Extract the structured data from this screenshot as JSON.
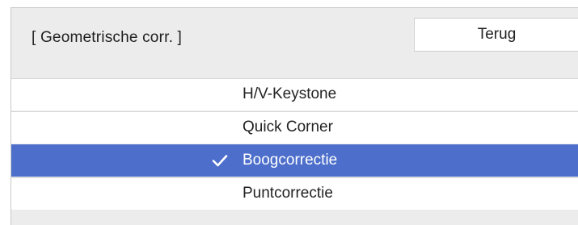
{
  "header": {
    "title": "[ Geometrische corr. ]",
    "back_label": "Terug"
  },
  "menu": {
    "items": [
      {
        "label": "H/V-Keystone",
        "selected": false
      },
      {
        "label": "Quick Corner",
        "selected": false
      },
      {
        "label": "Boogcorrectie",
        "selected": true
      },
      {
        "label": "Puntcorrectie",
        "selected": false
      }
    ]
  },
  "colors": {
    "panel_background": "#ececec",
    "item_background": "#ffffff",
    "selected_background": "#4d6fcb",
    "selected_text": "#ffffff",
    "text": "#222222"
  },
  "icons": {
    "selected_marker": "check-icon"
  }
}
